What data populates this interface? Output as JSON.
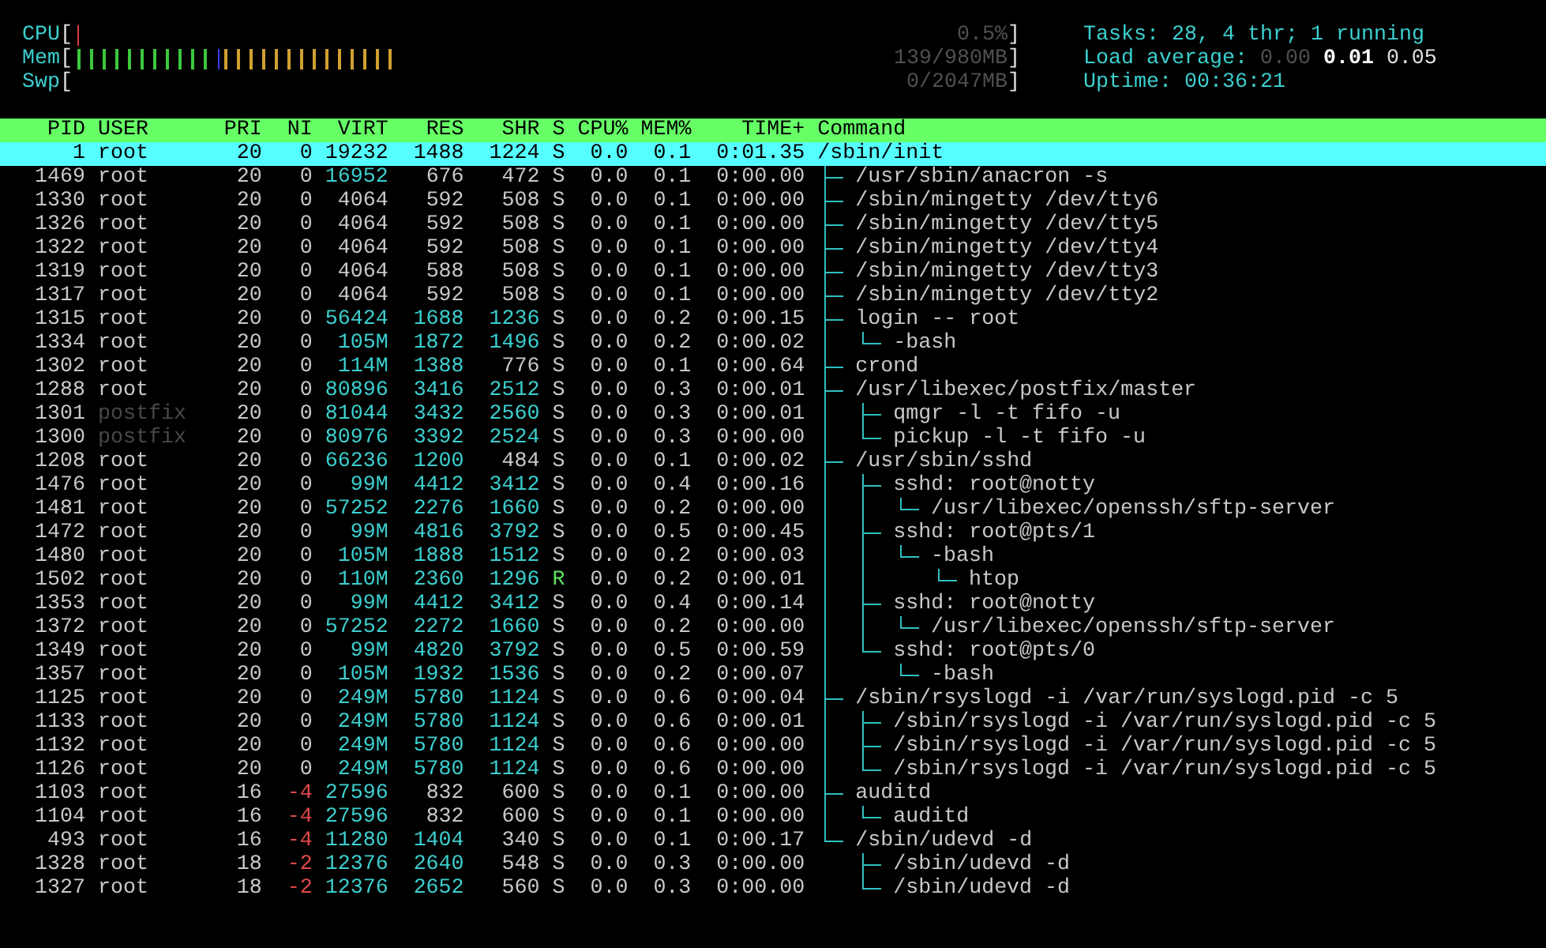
{
  "meters": [
    {
      "label": "CPU",
      "open": "[",
      "segments": [
        {
          "level": 0.007,
          "color": "#e03a3a"
        }
      ],
      "reading": "0.5%",
      "close": "]"
    },
    {
      "label": "Mem",
      "open": "[",
      "segments": [
        {
          "level": 0.15,
          "color": "#3cc83c"
        },
        {
          "level": 0.007,
          "color": "#3c3cf0"
        },
        {
          "level": 0.186,
          "color": "#d0a030"
        }
      ],
      "reading": "139/980MB",
      "close": "]"
    },
    {
      "label": "Swp",
      "open": "[",
      "reading": "0/2047MB",
      "close": "]"
    }
  ],
  "summary": [
    [
      {
        "text": "Tasks: 28, 4 thr; 1 running",
        "kind": "label"
      }
    ],
    [
      {
        "text": "Load average:",
        "kind": "label"
      },
      {
        "text": "0.00",
        "kind": "dim"
      },
      {
        "text": "0.01",
        "kind": "strong"
      },
      {
        "text": "0.05",
        "kind": "value"
      }
    ],
    [
      {
        "text": "Uptime: 00:36:21",
        "kind": "label"
      }
    ]
  ],
  "columns": [
    "PID",
    "USER",
    "PRI",
    "NI",
    "VIRT",
    "RES",
    "SHR",
    "S",
    "CPU%",
    "MEM%",
    "TIME+",
    "Command"
  ],
  "processes": [
    {
      "pid": "1",
      "user": "root",
      "pri": "20",
      "ni": "0",
      "virt": "19232",
      "res": "1488",
      "shr": "1224",
      "state": "S",
      "cpu": "0.0",
      "mem": "0.1",
      "time": "0:01.35",
      "command": "/sbin/init",
      "selected": true,
      "children": [
        {
          "pid": "1469",
          "user": "root",
          "pri": "20",
          "ni": "0",
          "virt": "16952",
          "res": "676",
          "shr": "472",
          "state": "S",
          "cpu": "0.0",
          "mem": "0.1",
          "time": "0:00.00",
          "command": "/usr/sbin/anacron -s",
          "selected": false,
          "other_user": false,
          "niced": false,
          "running": false,
          "virt_hi": true,
          "res_hi": false,
          "shr_hi": false
        },
        {
          "pid": "1330",
          "user": "root",
          "pri": "20",
          "ni": "0",
          "virt": "4064",
          "res": "592",
          "shr": "508",
          "state": "S",
          "cpu": "0.0",
          "mem": "0.1",
          "time": "0:00.00",
          "command": "/sbin/mingetty /dev/tty6",
          "selected": false,
          "other_user": false,
          "niced": false,
          "running": false,
          "virt_hi": false,
          "res_hi": false,
          "shr_hi": false
        },
        {
          "pid": "1326",
          "user": "root",
          "pri": "20",
          "ni": "0",
          "virt": "4064",
          "res": "592",
          "shr": "508",
          "state": "S",
          "cpu": "0.0",
          "mem": "0.1",
          "time": "0:00.00",
          "command": "/sbin/mingetty /dev/tty5",
          "selected": false,
          "other_user": false,
          "niced": false,
          "running": false,
          "virt_hi": false,
          "res_hi": false,
          "shr_hi": false
        },
        {
          "pid": "1322",
          "user": "root",
          "pri": "20",
          "ni": "0",
          "virt": "4064",
          "res": "592",
          "shr": "508",
          "state": "S",
          "cpu": "0.0",
          "mem": "0.1",
          "time": "0:00.00",
          "command": "/sbin/mingetty /dev/tty4",
          "selected": false,
          "other_user": false,
          "niced": false,
          "running": false,
          "virt_hi": false,
          "res_hi": false,
          "shr_hi": false
        },
        {
          "pid": "1319",
          "user": "root",
          "pri": "20",
          "ni": "0",
          "virt": "4064",
          "res": "588",
          "shr": "508",
          "state": "S",
          "cpu": "0.0",
          "mem": "0.1",
          "time": "0:00.00",
          "command": "/sbin/mingetty /dev/tty3",
          "selected": false,
          "other_user": false,
          "niced": false,
          "running": false,
          "virt_hi": false,
          "res_hi": false,
          "shr_hi": false
        },
        {
          "pid": "1317",
          "user": "root",
          "pri": "20",
          "ni": "0",
          "virt": "4064",
          "res": "592",
          "shr": "508",
          "state": "S",
          "cpu": "0.0",
          "mem": "0.1",
          "time": "0:00.00",
          "command": "/sbin/mingetty /dev/tty2",
          "selected": false,
          "other_user": false,
          "niced": false,
          "running": false,
          "virt_hi": false,
          "res_hi": false,
          "shr_hi": false
        },
        {
          "pid": "1315",
          "user": "root",
          "pri": "20",
          "ni": "0",
          "virt": "56424",
          "res": "1688",
          "shr": "1236",
          "state": "S",
          "cpu": "0.0",
          "mem": "0.2",
          "time": "0:00.15",
          "command": "login -- root",
          "selected": false,
          "other_user": false,
          "niced": false,
          "running": false,
          "virt_hi": true,
          "res_hi": true,
          "shr_hi": true,
          "children": [
            {
              "pid": "1334",
              "user": "root",
              "pri": "20",
              "ni": "0",
              "virt": "105M",
              "res": "1872",
              "shr": "1496",
              "state": "S",
              "cpu": "0.0",
              "mem": "0.2",
              "time": "0:00.02",
              "command": "-bash",
              "selected": false,
              "other_user": false,
              "niced": false,
              "running": false,
              "virt_hi": true,
              "res_hi": true,
              "shr_hi": true
            }
          ]
        },
        {
          "pid": "1302",
          "user": "root",
          "pri": "20",
          "ni": "0",
          "virt": "114M",
          "res": "1388",
          "shr": "776",
          "state": "S",
          "cpu": "0.0",
          "mem": "0.1",
          "time": "0:00.64",
          "command": "crond",
          "selected": false,
          "other_user": false,
          "niced": false,
          "running": false,
          "virt_hi": true,
          "res_hi": true,
          "shr_hi": false
        },
        {
          "pid": "1288",
          "user": "root",
          "pri": "20",
          "ni": "0",
          "virt": "80896",
          "res": "3416",
          "shr": "2512",
          "state": "S",
          "cpu": "0.0",
          "mem": "0.3",
          "time": "0:00.01",
          "command": "/usr/libexec/postfix/master",
          "selected": false,
          "other_user": false,
          "niced": false,
          "running": false,
          "virt_hi": true,
          "res_hi": true,
          "shr_hi": true,
          "children": [
            {
              "pid": "1301",
              "user": "postfix",
              "pri": "20",
              "ni": "0",
              "virt": "81044",
              "res": "3432",
              "shr": "2560",
              "state": "S",
              "cpu": "0.0",
              "mem": "0.3",
              "time": "0:00.01",
              "command": "qmgr -l -t fifo -u",
              "selected": false,
              "other_user": true,
              "niced": false,
              "running": false,
              "virt_hi": true,
              "res_hi": true,
              "shr_hi": true
            },
            {
              "pid": "1300",
              "user": "postfix",
              "pri": "20",
              "ni": "0",
              "virt": "80976",
              "res": "3392",
              "shr": "2524",
              "state": "S",
              "cpu": "0.0",
              "mem": "0.3",
              "time": "0:00.00",
              "command": "pickup -l -t fifo -u",
              "selected": false,
              "other_user": true,
              "niced": false,
              "running": false,
              "virt_hi": true,
              "res_hi": true,
              "shr_hi": true
            }
          ]
        },
        {
          "pid": "1208",
          "user": "root",
          "pri": "20",
          "ni": "0",
          "virt": "66236",
          "res": "1200",
          "shr": "484",
          "state": "S",
          "cpu": "0.0",
          "mem": "0.1",
          "time": "0:00.02",
          "command": "/usr/sbin/sshd",
          "selected": false,
          "other_user": false,
          "niced": false,
          "running": false,
          "virt_hi": true,
          "res_hi": true,
          "shr_hi": false,
          "children": [
            {
              "pid": "1476",
              "user": "root",
              "pri": "20",
              "ni": "0",
              "virt": "99M",
              "res": "4412",
              "shr": "3412",
              "state": "S",
              "cpu": "0.0",
              "mem": "0.4",
              "time": "0:00.16",
              "command": "sshd: root@notty",
              "selected": false,
              "other_user": false,
              "niced": false,
              "running": false,
              "virt_hi": true,
              "res_hi": true,
              "shr_hi": true,
              "children": [
                {
                  "pid": "1481",
                  "user": "root",
                  "pri": "20",
                  "ni": "0",
                  "virt": "57252",
                  "res": "2276",
                  "shr": "1660",
                  "state": "S",
                  "cpu": "0.0",
                  "mem": "0.2",
                  "time": "0:00.00",
                  "command": "/usr/libexec/openssh/sftp-server",
                  "selected": false,
                  "other_user": false,
                  "niced": false,
                  "running": false,
                  "virt_hi": true,
                  "res_hi": true,
                  "shr_hi": true
                }
              ]
            },
            {
              "pid": "1472",
              "user": "root",
              "pri": "20",
              "ni": "0",
              "virt": "99M",
              "res": "4816",
              "shr": "3792",
              "state": "S",
              "cpu": "0.0",
              "mem": "0.5",
              "time": "0:00.45",
              "command": "sshd: root@pts/1",
              "selected": false,
              "other_user": false,
              "niced": false,
              "running": false,
              "virt_hi": true,
              "res_hi": true,
              "shr_hi": true,
              "children": [
                {
                  "pid": "1480",
                  "user": "root",
                  "pri": "20",
                  "ni": "0",
                  "virt": "105M",
                  "res": "1888",
                  "shr": "1512",
                  "state": "S",
                  "cpu": "0.0",
                  "mem": "0.2",
                  "time": "0:00.03",
                  "command": "-bash",
                  "selected": false,
                  "other_user": false,
                  "niced": false,
                  "running": false,
                  "virt_hi": true,
                  "res_hi": true,
                  "shr_hi": true,
                  "children": [
                    {
                      "pid": "1502",
                      "user": "root",
                      "pri": "20",
                      "ni": "0",
                      "virt": "110M",
                      "res": "2360",
                      "shr": "1296",
                      "state": "R",
                      "cpu": "0.0",
                      "mem": "0.2",
                      "time": "0:00.01",
                      "command": "htop",
                      "selected": false,
                      "other_user": false,
                      "niced": false,
                      "running": true,
                      "virt_hi": true,
                      "res_hi": true,
                      "shr_hi": true
                    }
                  ]
                }
              ]
            },
            {
              "pid": "1353",
              "user": "root",
              "pri": "20",
              "ni": "0",
              "virt": "99M",
              "res": "4412",
              "shr": "3412",
              "state": "S",
              "cpu": "0.0",
              "mem": "0.4",
              "time": "0:00.14",
              "command": "sshd: root@notty",
              "selected": false,
              "other_user": false,
              "niced": false,
              "running": false,
              "virt_hi": true,
              "res_hi": true,
              "shr_hi": true,
              "children": [
                {
                  "pid": "1372",
                  "user": "root",
                  "pri": "20",
                  "ni": "0",
                  "virt": "57252",
                  "res": "2272",
                  "shr": "1660",
                  "state": "S",
                  "cpu": "0.0",
                  "mem": "0.2",
                  "time": "0:00.00",
                  "command": "/usr/libexec/openssh/sftp-server",
                  "selected": false,
                  "other_user": false,
                  "niced": false,
                  "running": false,
                  "virt_hi": true,
                  "res_hi": true,
                  "shr_hi": true
                }
              ]
            },
            {
              "pid": "1349",
              "user": "root",
              "pri": "20",
              "ni": "0",
              "virt": "99M",
              "res": "4820",
              "shr": "3792",
              "state": "S",
              "cpu": "0.0",
              "mem": "0.5",
              "time": "0:00.59",
              "command": "sshd: root@pts/0",
              "selected": false,
              "other_user": false,
              "niced": false,
              "running": false,
              "virt_hi": true,
              "res_hi": true,
              "shr_hi": true,
              "children": [
                {
                  "pid": "1357",
                  "user": "root",
                  "pri": "20",
                  "ni": "0",
                  "virt": "105M",
                  "res": "1932",
                  "shr": "1536",
                  "state": "S",
                  "cpu": "0.0",
                  "mem": "0.2",
                  "time": "0:00.07",
                  "command": "-bash",
                  "selected": false,
                  "other_user": false,
                  "niced": false,
                  "running": false,
                  "virt_hi": true,
                  "res_hi": true,
                  "shr_hi": true
                }
              ]
            }
          ]
        },
        {
          "pid": "1125",
          "user": "root",
          "pri": "20",
          "ni": "0",
          "virt": "249M",
          "res": "5780",
          "shr": "1124",
          "state": "S",
          "cpu": "0.0",
          "mem": "0.6",
          "time": "0:00.04",
          "command": "/sbin/rsyslogd -i /var/run/syslogd.pid -c 5",
          "selected": false,
          "other_user": false,
          "niced": false,
          "running": false,
          "virt_hi": true,
          "res_hi": true,
          "shr_hi": true,
          "children": [
            {
              "pid": "1133",
              "user": "root",
              "pri": "20",
              "ni": "0",
              "virt": "249M",
              "res": "5780",
              "shr": "1124",
              "state": "S",
              "cpu": "0.0",
              "mem": "0.6",
              "time": "0:00.01",
              "command": "/sbin/rsyslogd -i /var/run/syslogd.pid -c 5",
              "selected": false,
              "other_user": false,
              "niced": false,
              "running": false,
              "virt_hi": true,
              "res_hi": true,
              "shr_hi": true
            },
            {
              "pid": "1132",
              "user": "root",
              "pri": "20",
              "ni": "0",
              "virt": "249M",
              "res": "5780",
              "shr": "1124",
              "state": "S",
              "cpu": "0.0",
              "mem": "0.6",
              "time": "0:00.00",
              "command": "/sbin/rsyslogd -i /var/run/syslogd.pid -c 5",
              "selected": false,
              "other_user": false,
              "niced": false,
              "running": false,
              "virt_hi": true,
              "res_hi": true,
              "shr_hi": true
            },
            {
              "pid": "1126",
              "user": "root",
              "pri": "20",
              "ni": "0",
              "virt": "249M",
              "res": "5780",
              "shr": "1124",
              "state": "S",
              "cpu": "0.0",
              "mem": "0.6",
              "time": "0:00.00",
              "command": "/sbin/rsyslogd -i /var/run/syslogd.pid -c 5",
              "selected": false,
              "other_user": false,
              "niced": false,
              "running": false,
              "virt_hi": true,
              "res_hi": true,
              "shr_hi": true
            }
          ]
        },
        {
          "pid": "1103",
          "user": "root",
          "pri": "16",
          "ni": "-4",
          "virt": "27596",
          "res": "832",
          "shr": "600",
          "state": "S",
          "cpu": "0.0",
          "mem": "0.1",
          "time": "0:00.00",
          "command": "auditd",
          "selected": false,
          "other_user": false,
          "niced": true,
          "running": false,
          "virt_hi": true,
          "res_hi": false,
          "shr_hi": false,
          "children": [
            {
              "pid": "1104",
              "user": "root",
              "pri": "16",
              "ni": "-4",
              "virt": "27596",
              "res": "832",
              "shr": "600",
              "state": "S",
              "cpu": "0.0",
              "mem": "0.1",
              "time": "0:00.00",
              "command": "auditd",
              "selected": false,
              "other_user": false,
              "niced": true,
              "running": false,
              "virt_hi": true,
              "res_hi": false,
              "shr_hi": false
            }
          ]
        },
        {
          "pid": "493",
          "user": "root",
          "pri": "16",
          "ni": "-4",
          "virt": "11280",
          "res": "1404",
          "shr": "340",
          "state": "S",
          "cpu": "0.0",
          "mem": "0.1",
          "time": "0:00.17",
          "command": "/sbin/udevd -d",
          "selected": false,
          "other_user": false,
          "niced": true,
          "running": false,
          "virt_hi": true,
          "res_hi": true,
          "shr_hi": false,
          "children": [
            {
              "pid": "1328",
              "user": "root",
              "pri": "18",
              "ni": "-2",
              "virt": "12376",
              "res": "2640",
              "shr": "548",
              "state": "S",
              "cpu": "0.0",
              "mem": "0.3",
              "time": "0:00.00",
              "command": "/sbin/udevd -d",
              "selected": false,
              "other_user": false,
              "niced": true,
              "running": false,
              "virt_hi": true,
              "res_hi": true,
              "shr_hi": false
            },
            {
              "pid": "1327",
              "user": "root",
              "pri": "18",
              "ni": "-2",
              "virt": "12376",
              "res": "2652",
              "shr": "560",
              "state": "S",
              "cpu": "0.0",
              "mem": "0.3",
              "time": "0:00.00",
              "command": "/sbin/udevd -d",
              "selected": false,
              "other_user": false,
              "niced": true,
              "running": false,
              "virt_hi": true,
              "res_hi": true,
              "shr_hi": false
            }
          ]
        }
      ]
    }
  ]
}
